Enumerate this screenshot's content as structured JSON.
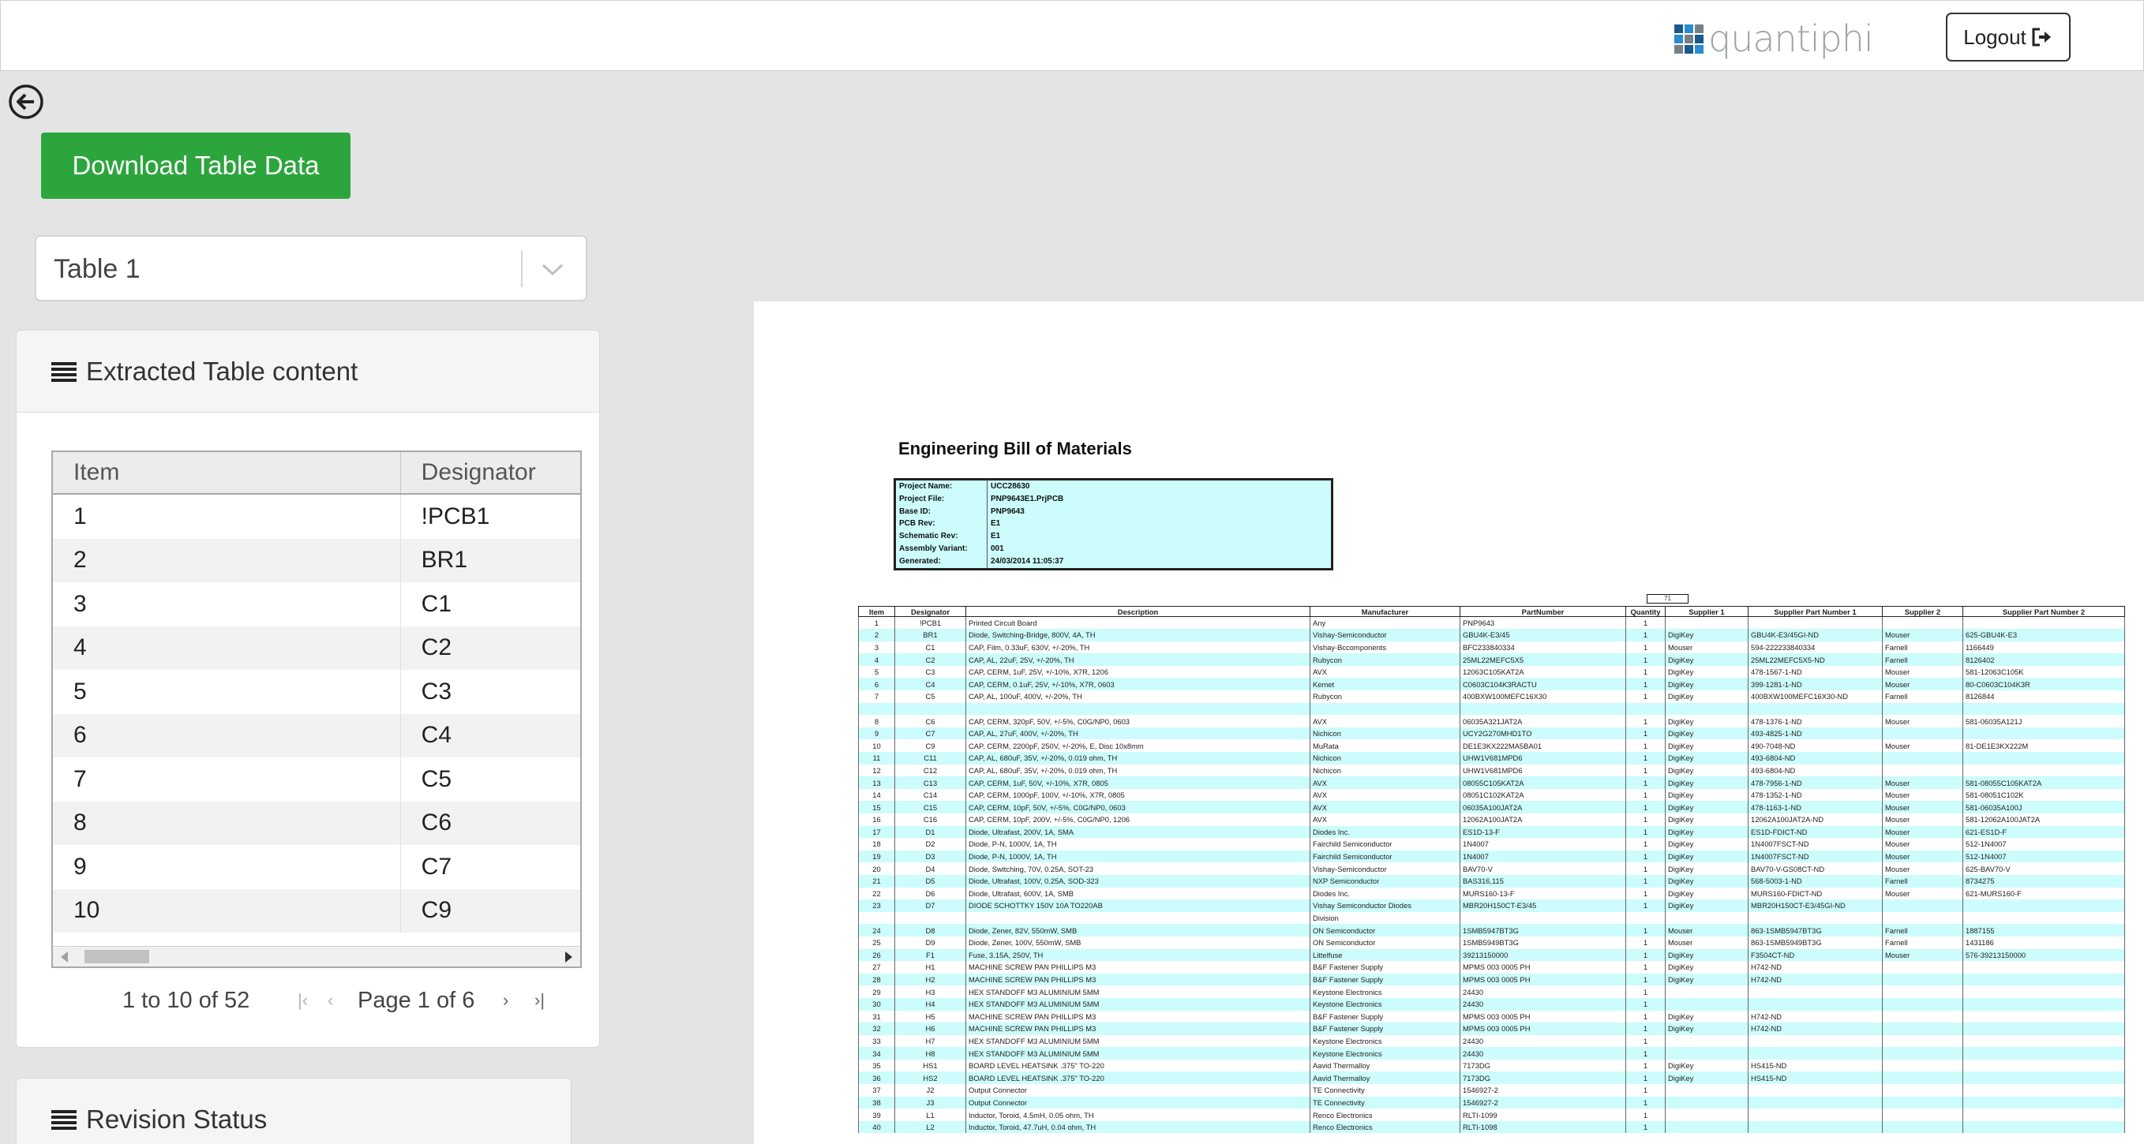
{
  "header": {
    "logo_text": "quantiphi",
    "logo_colors": [
      "#1b5a8c",
      "#2a8ccf",
      "#7a7f85",
      "#2a8ccf",
      "#7a7f85",
      "#1b5a8c",
      "#7a7f85",
      "#1b5a8c",
      "#2a8ccf"
    ],
    "logout_label": "Logout",
    "logout_icon": "sign-out-icon"
  },
  "back_icon": "arrow-circle-left-icon",
  "download_label": "Download Table Data",
  "table_select": {
    "value": "Table 1"
  },
  "extracted_panel": {
    "title": "Extracted Table content",
    "columns": [
      "Item",
      "Designator"
    ],
    "rows": [
      [
        "1",
        "!PCB1"
      ],
      [
        "2",
        "BR1"
      ],
      [
        "3",
        "C1"
      ],
      [
        "4",
        "C2"
      ],
      [
        "5",
        "C3"
      ],
      [
        "6",
        "C4"
      ],
      [
        "7",
        "C5"
      ],
      [
        "8",
        "C6"
      ],
      [
        "9",
        "C7"
      ],
      [
        "10",
        "C9"
      ]
    ],
    "pager_count": "1 to 10 of 52",
    "pager_page": "Page 1 of 6"
  },
  "revision_panel": {
    "title": "Revision Status"
  },
  "document": {
    "title": "Engineering Bill of Materials",
    "info": [
      [
        "Project Name:",
        "UCC28630"
      ],
      [
        "Project File:",
        "PNP9643E1.PrjPCB"
      ],
      [
        "Base ID:",
        "PNP9643"
      ],
      [
        "PCB Rev:",
        "E1"
      ],
      [
        "Schematic Rev:",
        "E1"
      ],
      [
        "Assembly Variant:",
        "001"
      ],
      [
        "Generated:",
        "24/03/2014 11:05:37"
      ]
    ],
    "qty_note": "71",
    "bom_columns": [
      "Item",
      "Designator",
      "Description",
      "Manufacturer",
      "PartNumber",
      "Quantity",
      "Supplier 1",
      "Supplier Part Number 1",
      "Supplier 2",
      "Supplier Part Number 2"
    ],
    "bom_rows": [
      [
        "1",
        "!PCB1",
        "Printed Circuit Board",
        "Any",
        "PNP9643",
        "1",
        "",
        "",
        "",
        ""
      ],
      [
        "2",
        "BR1",
        "Diode, Switching-Bridge, 800V, 4A, TH",
        "Vishay-Semiconductor",
        "GBU4K-E3/45",
        "1",
        "DigiKey",
        "GBU4K-E3/45GI-ND",
        "Mouser",
        "625-GBU4K-E3"
      ],
      [
        "3",
        "C1",
        "CAP, Film, 0.33uF, 630V, +/-20%, TH",
        "Vishay-Bccomponents",
        "BFC233840334",
        "1",
        "Mouser",
        "594-222233840334",
        "Farnell",
        "1166449"
      ],
      [
        "4",
        "C2",
        "CAP, AL, 22uF, 25V, +/-20%, TH",
        "Rubycon",
        "25ML22MEFC5X5",
        "1",
        "DigiKey",
        "25ML22MEFC5X5-ND",
        "Farnell",
        "8126402"
      ],
      [
        "5",
        "C3",
        "CAP, CERM, 1uF, 25V, +/-10%, X7R, 1206",
        "AVX",
        "12063C105KAT2A",
        "1",
        "DigiKey",
        "478-1567-1-ND",
        "Mouser",
        "581-12063C105K"
      ],
      [
        "6",
        "C4",
        "CAP, CERM, 0.1uF, 25V, +/-10%, X7R, 0603",
        "Kemet",
        "C0603C104K3RACTU",
        "1",
        "DigiKey",
        "399-1281-1-ND",
        "Mouser",
        "80-C0603C104K3R"
      ],
      [
        "7",
        "C5",
        "CAP, AL, 100uF, 400V, +/-20%, TH",
        "Rubycon",
        "400BXW100MEFC16X30",
        "1",
        "DigiKey",
        "400BXW100MEFC16X30-ND",
        "Farnell",
        "8126844"
      ],
      [
        "",
        "",
        "",
        "",
        "",
        "",
        "",
        "",
        "",
        ""
      ],
      [
        "8",
        "C6",
        "CAP, CERM, 320pF, 50V, +/-5%, C0G/NP0, 0603",
        "AVX",
        "06035A321JAT2A",
        "1",
        "DigiKey",
        "478-1376-1-ND",
        "Mouser",
        "581-06035A121J"
      ],
      [
        "9",
        "C7",
        "CAP, AL, 27uF, 400V, +/-20%, TH",
        "Nichicon",
        "UCY2G270MHD1TO",
        "1",
        "DigiKey",
        "493-4825-1-ND",
        "",
        ""
      ],
      [
        "10",
        "C9",
        "CAP, CERM, 2200pF, 250V, +/-20%, E, Disc 10x8mm",
        "MuRata",
        "DE1E3KX222MA5BA01",
        "1",
        "DigiKey",
        "490-7048-ND",
        "Mouser",
        "81-DE1E3KX222M"
      ],
      [
        "11",
        "C11",
        "CAP, AL, 680uF, 35V, +/-20%, 0.019 ohm, TH",
        "Nichicon",
        "UHW1V681MPD6",
        "1",
        "DigiKey",
        "493-6804-ND",
        "",
        ""
      ],
      [
        "12",
        "C12",
        "CAP, AL, 680uF, 35V, +/-20%, 0.019 ohm, TH",
        "Nichicon",
        "UHW1V681MPD6",
        "1",
        "DigiKey",
        "493-6804-ND",
        "",
        ""
      ],
      [
        "13",
        "C13",
        "CAP, CERM, 1uF, 50V, +/-10%, X7R, 0805",
        "AVX",
        "08055C105KAT2A",
        "1",
        "DigiKey",
        "478-7956-1-ND",
        "Mouser",
        "581-08055C105KAT2A"
      ],
      [
        "14",
        "C14",
        "CAP, CERM, 1000pF, 100V, +/-10%, X7R, 0805",
        "AVX",
        "08051C102KAT2A",
        "1",
        "DigiKey",
        "478-1352-1-ND",
        "Mouser",
        "581-08051C102K"
      ],
      [
        "15",
        "C15",
        "CAP, CERM, 10pF, 50V, +/-5%, C0G/NP0, 0603",
        "AVX",
        "06035A100JAT2A",
        "1",
        "DigiKey",
        "478-1163-1-ND",
        "Mouser",
        "581-06035A100J"
      ],
      [
        "16",
        "C16",
        "CAP, CERM, 10pF, 200V, +/-5%, C0G/NP0, 1206",
        "AVX",
        "12062A100JAT2A",
        "1",
        "DigiKey",
        "12062A100JAT2A-ND",
        "Mouser",
        "581-12062A100JAT2A"
      ],
      [
        "17",
        "D1",
        "Diode, Ultrafast, 200V, 1A, SMA",
        "Diodes Inc.",
        "ES1D-13-F",
        "1",
        "DigiKey",
        "ES1D-FDICT-ND",
        "Mouser",
        "621-ES1D-F"
      ],
      [
        "18",
        "D2",
        "Diode, P-N, 1000V, 1A, TH",
        "Fairchild Semiconductor",
        "1N4007",
        "1",
        "DigiKey",
        "1N4007FSCT-ND",
        "Mouser",
        "512-1N4007"
      ],
      [
        "19",
        "D3",
        "Diode, P-N, 1000V, 1A, TH",
        "Fairchild Semiconductor",
        "1N4007",
        "1",
        "DigiKey",
        "1N4007FSCT-ND",
        "Mouser",
        "512-1N4007"
      ],
      [
        "20",
        "D4",
        "Diode, Switching, 70V, 0.25A, SOT-23",
        "Vishay-Semiconductor",
        "BAV70-V",
        "1",
        "DigiKey",
        "BAV70-V-GS08CT-ND",
        "Mouser",
        "625-BAV70-V"
      ],
      [
        "21",
        "D5",
        "Diode, Ultrafast, 100V, 0.25A, SOD-323",
        "NXP Semiconductor",
        "BAS316,115",
        "1",
        "DigiKey",
        "568-5003-1-ND",
        "Farnell",
        "8734275"
      ],
      [
        "22",
        "D6",
        "Diode, Ultrafast, 600V, 1A, SMB",
        "Diodes Inc.",
        "MURS160-13-F",
        "1",
        "DigiKey",
        "MURS160-FDICT-ND",
        "Mouser",
        "621-MURS160-F"
      ],
      [
        "23",
        "D7",
        "DIODE SCHOTTKY 150V 10A TO220AB",
        "Vishay Semiconductor Diodes",
        "MBR20H150CT-E3/45",
        "1",
        "DigiKey",
        "MBR20H150CT-E3/45GI-ND",
        "",
        ""
      ],
      [
        "",
        "",
        "",
        "Division",
        "",
        "",
        "",
        "",
        "",
        ""
      ],
      [
        "24",
        "D8",
        "Diode, Zener, 82V, 550mW, SMB",
        "ON Semiconductor",
        "1SMB5947BT3G",
        "1",
        "Mouser",
        "863-1SMB5947BT3G",
        "Farnell",
        "1887155"
      ],
      [
        "25",
        "D9",
        "Diode, Zener, 100V, 550mW, SMB",
        "ON Semiconductor",
        "1SMB5949BT3G",
        "1",
        "Mouser",
        "863-1SMB5949BT3G",
        "Farnell",
        "1431186"
      ],
      [
        "26",
        "F1",
        "Fuse, 3.15A, 250V, TH",
        "Littelfuse",
        "39213150000",
        "1",
        "DigiKey",
        "F3504CT-ND",
        "Mouser",
        "576-39213150000"
      ],
      [
        "27",
        "H1",
        "MACHINE SCREW PAN PHILLIPS M3",
        "B&F Fastener Supply",
        "MPMS 003 0005 PH",
        "1",
        "DigiKey",
        "H742-ND",
        "",
        ""
      ],
      [
        "28",
        "H2",
        "MACHINE SCREW PAN PHILLIPS M3",
        "B&F Fastener Supply",
        "MPMS 003 0005 PH",
        "1",
        "DigiKey",
        "H742-ND",
        "",
        ""
      ],
      [
        "29",
        "H3",
        "HEX STANDOFF M3 ALUMINIUM 5MM",
        "Keystone Electronics",
        "24430",
        "1",
        "",
        "",
        "",
        ""
      ],
      [
        "30",
        "H4",
        "HEX STANDOFF M3 ALUMINIUM 5MM",
        "Keystone Electronics",
        "24430",
        "1",
        "",
        "",
        "",
        ""
      ],
      [
        "31",
        "H5",
        "MACHINE SCREW PAN PHILLIPS M3",
        "B&F Fastener Supply",
        "MPMS 003 0005 PH",
        "1",
        "DigiKey",
        "H742-ND",
        "",
        ""
      ],
      [
        "32",
        "H6",
        "MACHINE SCREW PAN PHILLIPS M3",
        "B&F Fastener Supply",
        "MPMS 003 0005 PH",
        "1",
        "DigiKey",
        "H742-ND",
        "",
        ""
      ],
      [
        "33",
        "H7",
        "HEX STANDOFF M3 ALUMINIUM 5MM",
        "Keystone Electronics",
        "24430",
        "1",
        "",
        "",
        "",
        ""
      ],
      [
        "34",
        "H8",
        "HEX STANDOFF M3 ALUMINIUM 5MM",
        "Keystone Electronics",
        "24430",
        "1",
        "",
        "",
        "",
        ""
      ],
      [
        "35",
        "HS1",
        "BOARD LEVEL HEATSINK .375\" TO-220",
        "Aavid Thermalloy",
        "7173DG",
        "1",
        "DigiKey",
        "HS415-ND",
        "",
        ""
      ],
      [
        "36",
        "HS2",
        "BOARD LEVEL HEATSINK .375\" TO-220",
        "Aavid Thermalloy",
        "7173DG",
        "1",
        "DigiKey",
        "HS415-ND",
        "",
        ""
      ],
      [
        "37",
        "J2",
        "Output Connector",
        "TE Connectivity",
        "1546927-2",
        "1",
        "",
        "",
        "",
        ""
      ],
      [
        "38",
        "J3",
        "Output Connector",
        "TE Connectivity",
        "1546927-2",
        "1",
        "",
        "",
        "",
        ""
      ],
      [
        "39",
        "L1",
        "Inductor, Toroid, 4.5mH, 0.05 ohm, TH",
        "Renco Electronics",
        "RLTI-1099",
        "1",
        "",
        "",
        "",
        ""
      ],
      [
        "40",
        "L2",
        "Inductor, Toroid, 47.7uH, 0.04 ohm, TH",
        "Renco Electronics",
        "RLTI-1098",
        "1",
        "",
        "",
        "",
        ""
      ]
    ]
  }
}
